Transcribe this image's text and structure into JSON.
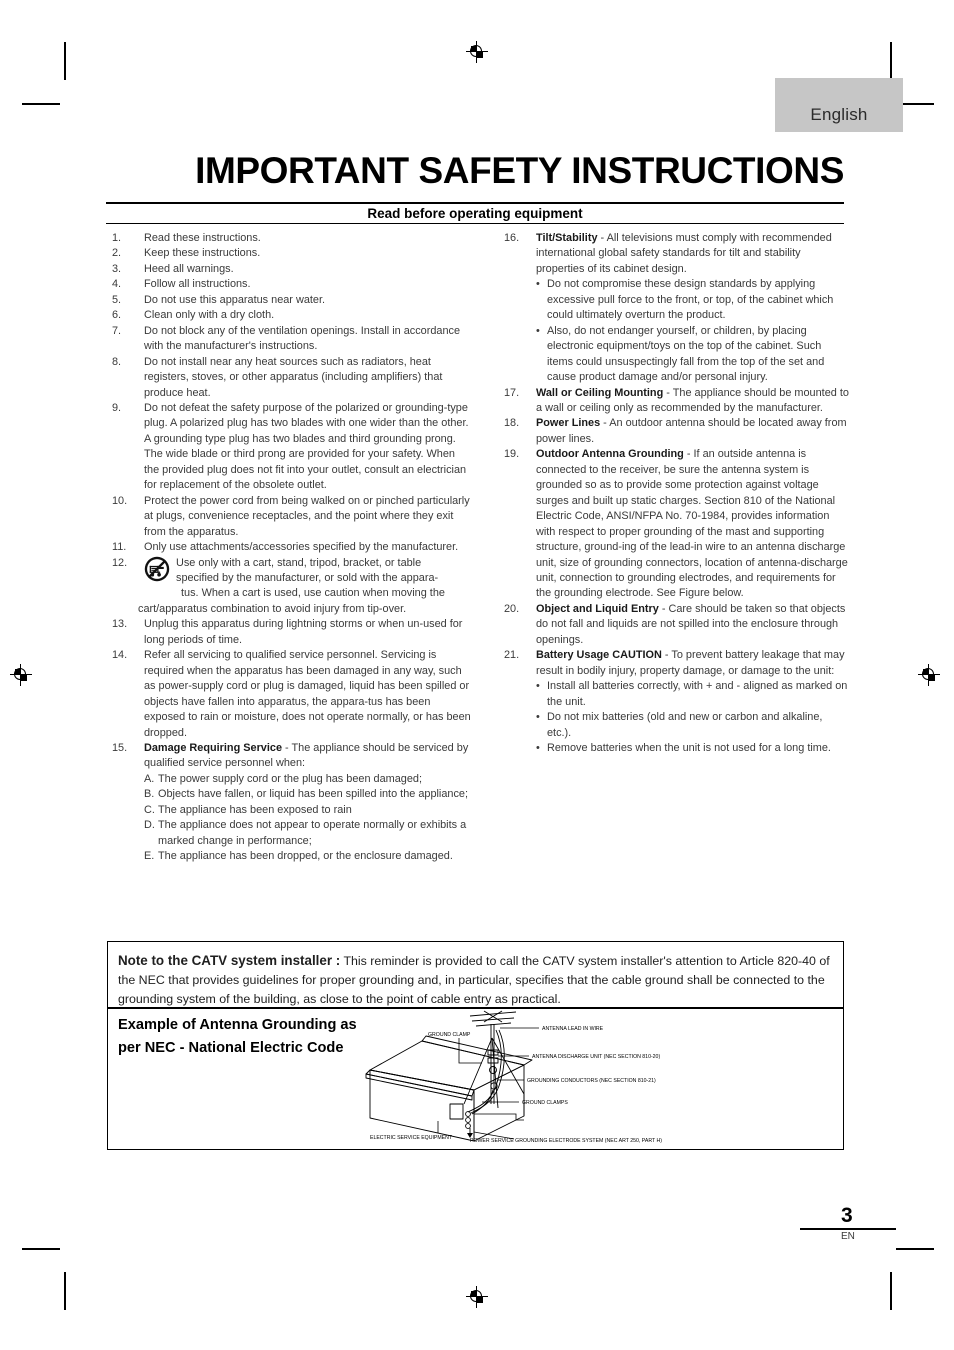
{
  "language_tab": {
    "label": "English"
  },
  "header": {
    "title": "IMPORTANT SAFETY INSTRUCTIONS",
    "subtitle": "Read before operating equipment"
  },
  "left_column": {
    "items": [
      {
        "num": "1.",
        "text": "Read these instructions."
      },
      {
        "num": "2.",
        "text": "Keep these instructions."
      },
      {
        "num": "3.",
        "text": "Heed all warnings."
      },
      {
        "num": "4.",
        "text": "Follow all instructions."
      },
      {
        "num": "5.",
        "text": "Do not use this apparatus near water."
      },
      {
        "num": "6.",
        "text": "Clean only with a dry cloth."
      },
      {
        "num": "7.",
        "text": "Do not block any of the ventilation openings. Install in accordance with the manufacturer's instructions."
      },
      {
        "num": "8.",
        "text": "Do not install near any heat sources such as radiators, heat registers, stoves, or other apparatus (including amplifiers) that produce heat."
      },
      {
        "num": "9.",
        "text": "Do not defeat the safety purpose of the polarized or grounding-type plug. A polarized plug has two blades with one wider than the other. A grounding type plug has two blades and third grounding prong. The wide blade or third prong are provided for your safety. When the provided plug does not fit into your outlet, consult an electrician for replacement of the obsolete outlet."
      },
      {
        "num": "10.",
        "text": "Protect the power cord from being walked on or pinched particularly at plugs, convenience receptacles, and the point where they exit from the apparatus."
      },
      {
        "num": "11.",
        "text": "Only use attachments/accessories specified by the manufacturer."
      }
    ],
    "item12": {
      "num": "12.",
      "icon": "cart-warning-icon",
      "line1": "Use only with a cart, stand, tripod, bracket, or table",
      "line2": "specified by the manufacturer, or sold with the appara-",
      "line3": "tus. When a cart is used, use caution when moving the",
      "line4": "cart/apparatus combination to avoid injury from tip-over."
    },
    "items_after": [
      {
        "num": "13.",
        "text": "Unplug this apparatus during lightning storms or when un-used for long periods of time."
      },
      {
        "num": "14.",
        "text": "Refer all servicing to qualified service personnel. Servicing is required when the apparatus has been damaged in any way, such as power-supply cord or plug is damaged, liquid has been spilled or objects have fallen into apparatus, the appara-tus has been exposed to rain or moisture, does not operate normally, or has been dropped."
      }
    ],
    "item15": {
      "num": "15.",
      "lead": "Damage Requiring Service",
      "text": " - The appliance should be serviced by qualified service personnel when:",
      "sub": [
        {
          "alpha": "A.",
          "text": "The power supply cord or the plug has been damaged;"
        },
        {
          "alpha": "B.",
          "text": "Objects have fallen, or liquid has been spilled into the appliance;"
        },
        {
          "alpha": "C.",
          "text": "The appliance has been exposed to rain"
        },
        {
          "alpha": "D.",
          "text": "The appliance does not appear to operate normally or exhibits a marked change in performance;"
        },
        {
          "alpha": "E.",
          "text": "The appliance has been dropped, or the enclosure damaged."
        }
      ]
    }
  },
  "right_column": {
    "item16": {
      "num": "16.",
      "lead": "Tilt/Stability",
      "text": " - All televisions must comply with recommended international global safety standards for tilt and stability properties of its cabinet design.",
      "bullets": [
        "Do not compromise these design standards by applying excessive pull force to the front, or top, of the cabinet which could ultimately overturn the product.",
        "Also, do not endanger yourself, or children, by placing electronic equipment/toys on the top of the cabinet. Such items could unsuspectingly fall from the top of the set and cause product damage and/or personal injury."
      ]
    },
    "item17": {
      "num": "17.",
      "lead": "Wall or Ceiling Mounting",
      "text": " - The appliance should be mounted to a wall or ceiling only as recommended by the manufacturer."
    },
    "item18": {
      "num": "18.",
      "lead": "Power Lines",
      "text": " - An outdoor antenna should be located away from power lines."
    },
    "item19": {
      "num": "19.",
      "lead": "Outdoor Antenna Grounding",
      "text": " - If an outside antenna is connected to the receiver, be sure the antenna system is grounded so as to provide some protection against voltage surges and built up static charges. Section 810 of the National Electric Code, ANSI/NFPA No. 70-1984, provides information with respect to proper grounding of the mast and supporting structure, ground-ing of the lead-in wire to an antenna discharge unit, size of grounding connectors, location of antenna-discharge unit, connection to grounding electrodes, and requirements for the grounding electrode. See Figure below."
    },
    "item20": {
      "num": "20.",
      "lead": "Object and Liquid Entry",
      "text": " - Care should be taken so that objects do not fall and liquids are not spilled into the enclosure through openings."
    },
    "item21": {
      "num": "21.",
      "lead": "Battery Usage CAUTION",
      "text": " - To prevent battery leakage that may result in bodily injury, property damage, or damage to the unit:",
      "bullets": [
        "Install all batteries correctly, with + and - aligned as marked on the unit.",
        "Do not mix batteries (old and new or carbon and alkaline, etc.).",
        "Remove batteries when the unit is not used for a long time."
      ]
    }
  },
  "catv_box": {
    "note_lead": "Note to the CATV system installer :",
    "note_text": " This reminder is provided to call the CATV system installer's attention to Article 820-40 of the NEC that provides guidelines for proper grounding and, in particular, specifies that the cable ground shall be connected to the grounding system of the building, as close to the point of cable entry as practical.",
    "example_heading_line1": "Example of Antenna Grounding as",
    "example_heading_line2": "per NEC - National Electric Code",
    "diagram_labels": {
      "ground_clamp": "GROUND CLAMP",
      "antenna_lead_in_wire": "ANTENNA LEAD IN WIRE",
      "antenna_discharge_unit": "ANTENNA DISCHARGE UNIT (NEC SECTION 810-20)",
      "grounding_conductors": "GROUNDING CONDUCTORS (NEC SECTION 810-21)",
      "ground_clamps": "GROUND CLAMPS",
      "electric_service_equipment": "ELECTRIC SERVICE EQUIPMENT",
      "power_service_grounding": "POWER SERVICE GROUNDING ELECTRODE SYSTEM (NEC ART 250, PART H)"
    }
  },
  "folio": {
    "page_number": "3",
    "language_code": "EN"
  },
  "colors": {
    "tab_background": "#c6c6c6",
    "rule": "#000000",
    "body_text": "#3a3a3a",
    "heading_text": "#000000"
  }
}
